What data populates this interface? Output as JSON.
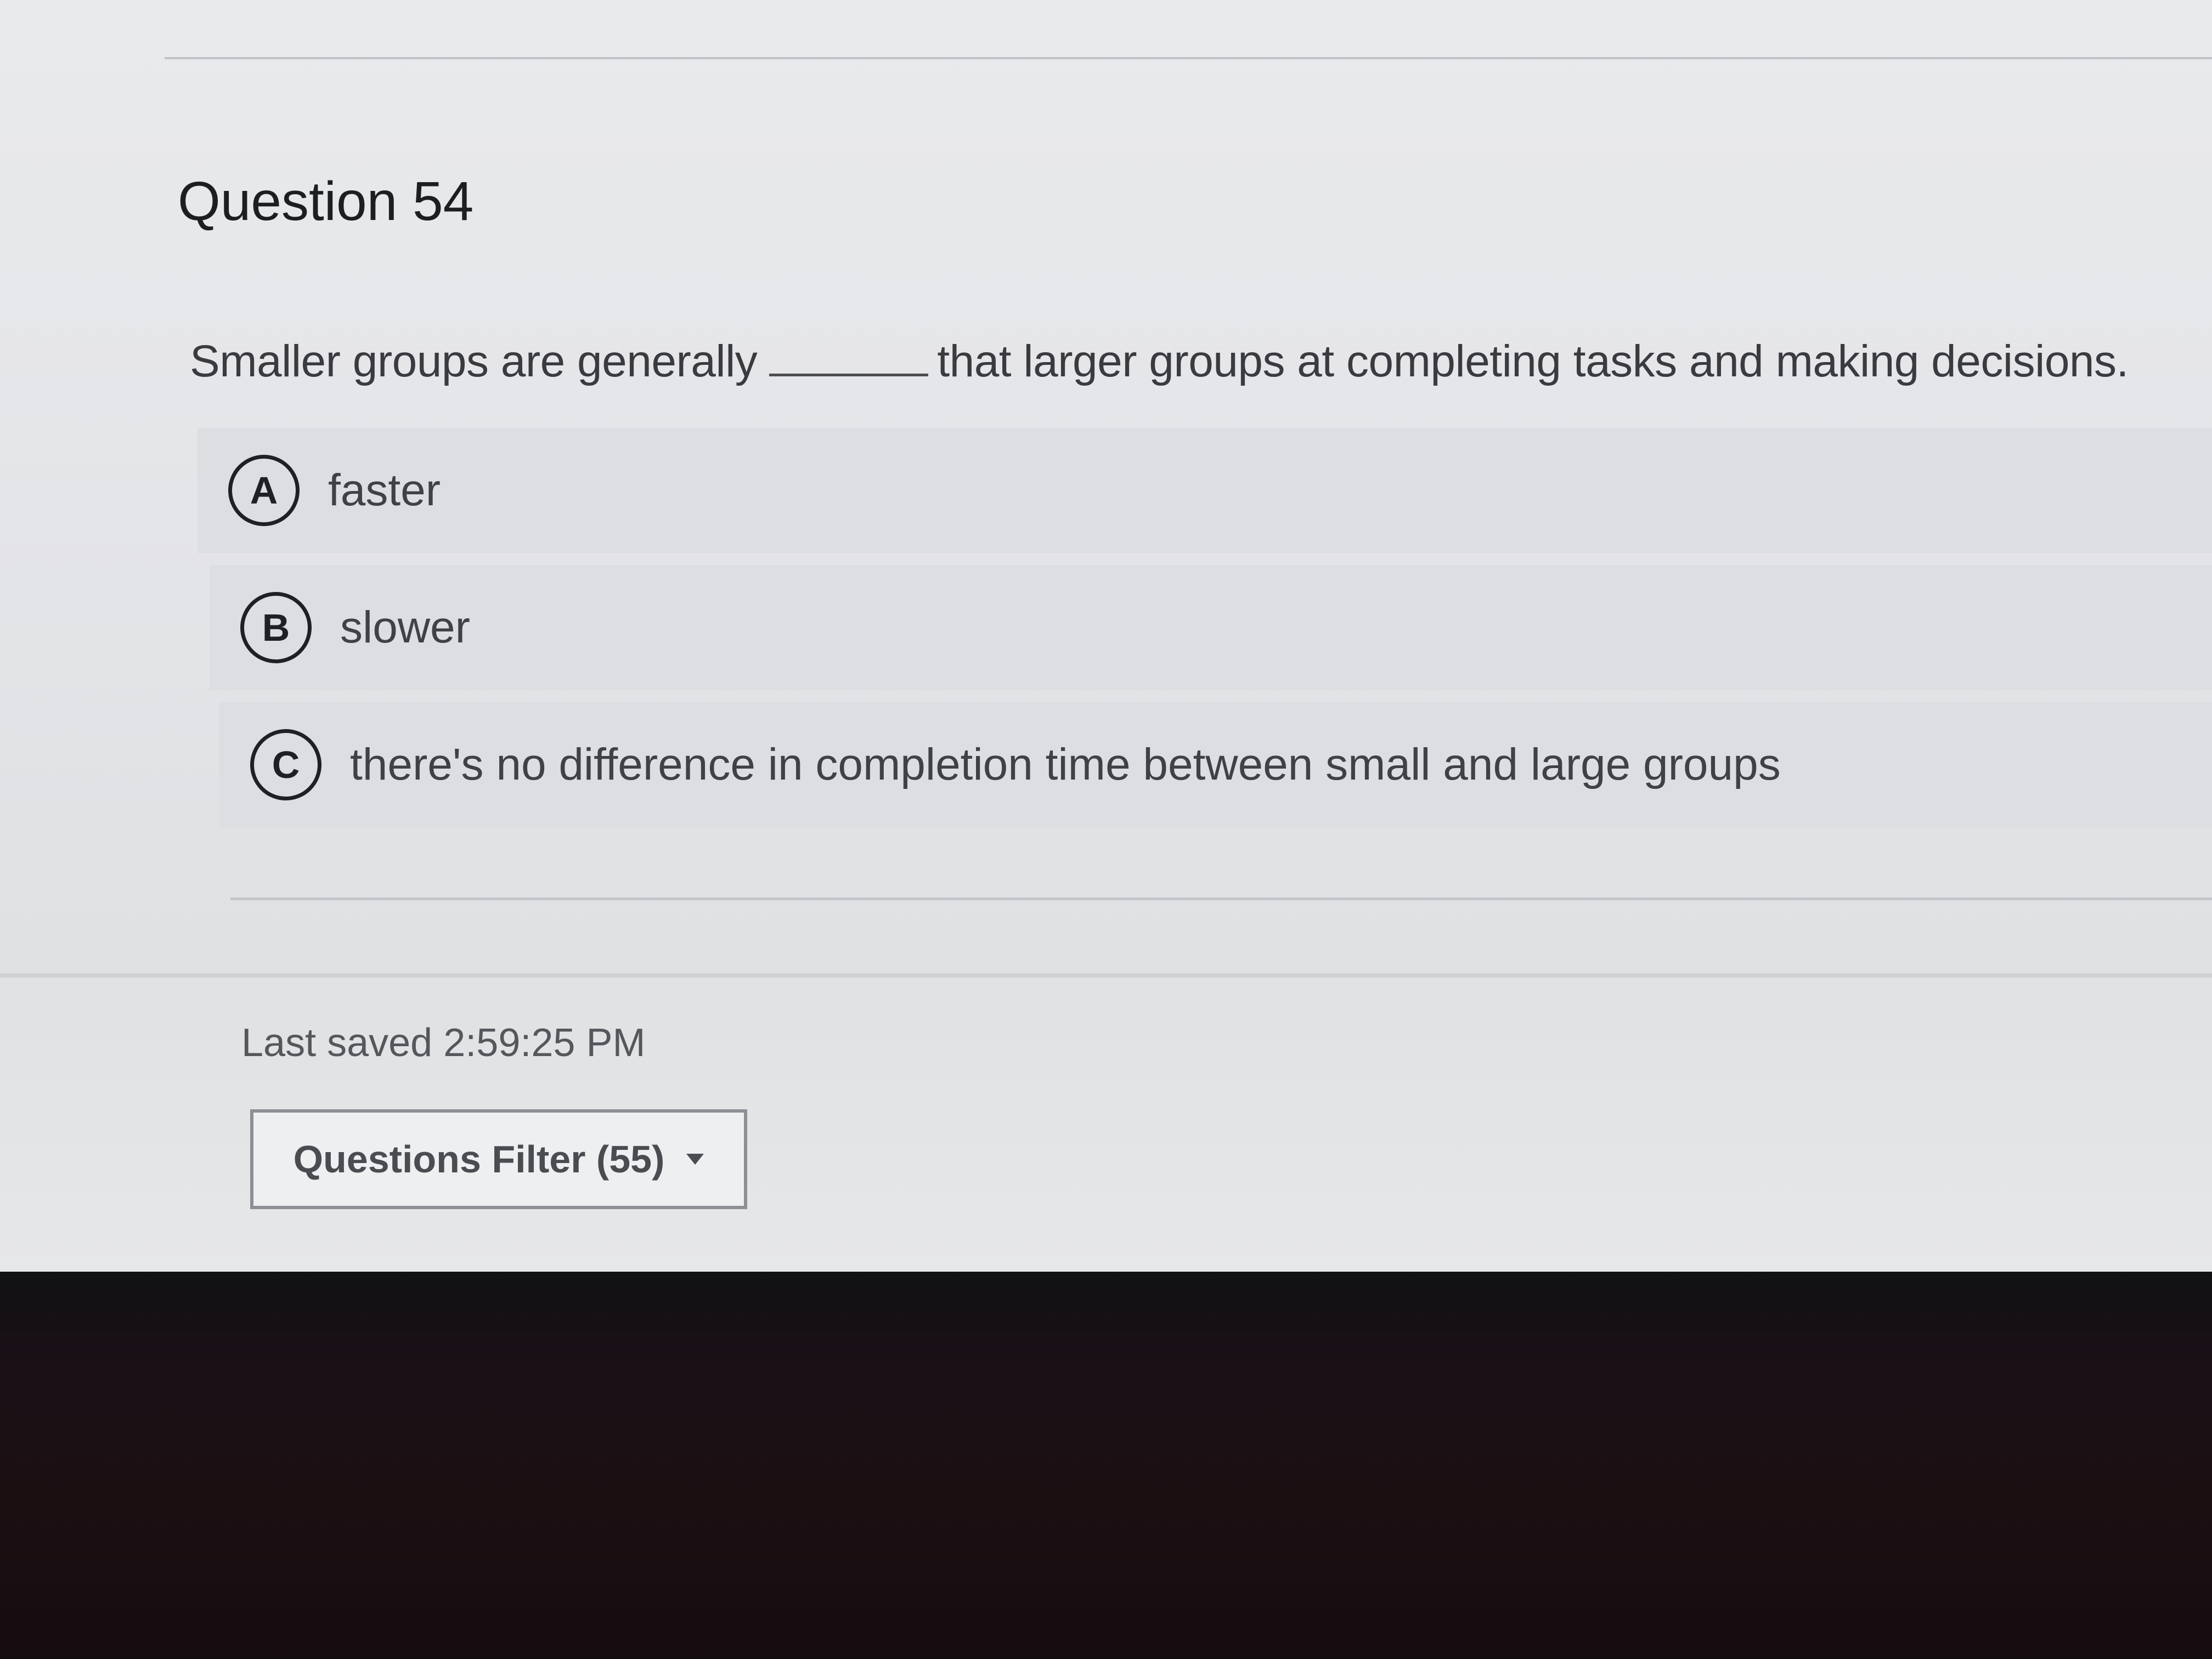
{
  "question": {
    "title": "Question 54",
    "prompt_before": "Smaller groups are generally",
    "prompt_after": "that larger groups at completing tasks and making decisions.",
    "choices": [
      {
        "letter": "A",
        "text": "faster"
      },
      {
        "letter": "B",
        "text": "slower"
      },
      {
        "letter": "C",
        "text": "there's no difference in completion time between small and large groups"
      }
    ]
  },
  "footer": {
    "last_saved": "Last saved 2:59:25 PM",
    "filter_button_label": "Questions Filter (55)",
    "filter_icon": "caret-down-icon"
  }
}
